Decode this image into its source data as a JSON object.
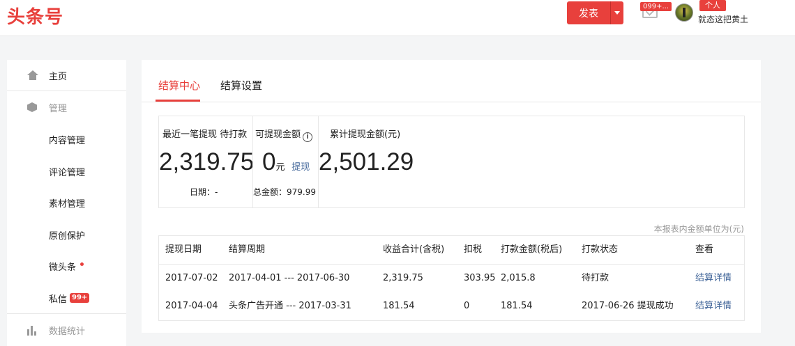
{
  "header": {
    "logo": "头条号",
    "publish_label": "发表",
    "mail_badge": "099+...",
    "user_tag": "个人",
    "user_name": "就态这把黄土"
  },
  "sidebar": {
    "items": [
      {
        "label": "主页",
        "icon": "home-icon"
      },
      {
        "label": "管理",
        "icon": "cube-icon"
      },
      {
        "label": "内容管理"
      },
      {
        "label": "评论管理"
      },
      {
        "label": "素材管理"
      },
      {
        "label": "原创保护"
      },
      {
        "label": "微头条"
      },
      {
        "label": "私信",
        "badge": "99+"
      },
      {
        "label": "数据统计",
        "icon": "bar-chart-icon"
      }
    ]
  },
  "tabs": [
    {
      "label": "结算中心",
      "active": true
    },
    {
      "label": "结算设置",
      "active": false
    }
  ],
  "summary": {
    "recent": {
      "label": "最近一笔提现 待打款",
      "value": "2,319.75",
      "sub": "日期：-"
    },
    "available": {
      "label": "可提现金额",
      "value": "0",
      "unit": "元",
      "action": "提现",
      "sub": "总金额：979.99"
    },
    "total": {
      "label": "累计提现金额(元)",
      "value": "2,501.29"
    }
  },
  "note": "本报表内金额单位为(元)",
  "table": {
    "columns": [
      "提现日期",
      "结算周期",
      "收益合计(含税)",
      "扣税",
      "打款金额(税后)",
      "打款状态",
      "查看"
    ],
    "rows": [
      [
        "2017-07-02",
        "2017-04-01 --- 2017-06-30",
        "2,319.75",
        "303.95",
        "2,015.8",
        "待打款",
        "结算详情"
      ],
      [
        "2017-04-04",
        "头条广告开通 --- 2017-03-31",
        "181.54",
        "0",
        "181.54",
        "2017-06-26 提现成功",
        "结算详情"
      ]
    ]
  },
  "colors": {
    "accent": "#e8403c",
    "link": "#406599"
  }
}
